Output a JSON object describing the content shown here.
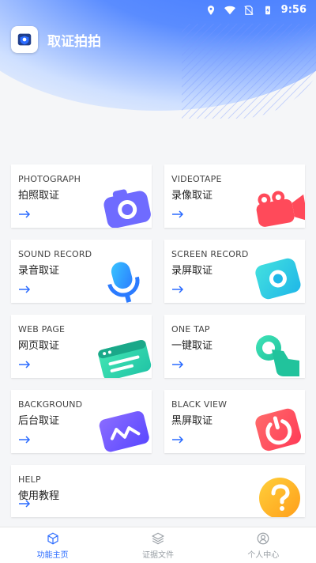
{
  "status": {
    "time": "9:56"
  },
  "app": {
    "title": "取证拍拍"
  },
  "cards": [
    {
      "en": "PHOTOGRAPH",
      "cn": "拍照取证",
      "icon": "camera-icon",
      "color": "#6f6bff"
    },
    {
      "en": "VIDEOTAPE",
      "cn": "录像取证",
      "icon": "video-camera-icon",
      "color": "#ff4a5a"
    },
    {
      "en": "SOUND RECORD",
      "cn": "录音取证",
      "icon": "microphone-icon",
      "color": "#2ea7ff"
    },
    {
      "en": "SCREEN RECORD",
      "cn": "录屏取证",
      "icon": "screen-record-icon",
      "color": "#29c7e6"
    },
    {
      "en": "WEB PAGE",
      "cn": "网页取证",
      "icon": "browser-icon",
      "color": "#2fd1b0"
    },
    {
      "en": "ONE TAP",
      "cn": "一键取证",
      "icon": "tap-icon",
      "color": "#27c9a1"
    },
    {
      "en": "BACKGROUND",
      "cn": "后台取证",
      "icon": "background-icon",
      "color": "#7b5cff"
    },
    {
      "en": "BLACK VIEW",
      "cn": "黑屏取证",
      "icon": "power-icon",
      "color": "#ff4a5a"
    },
    {
      "en": "HELP",
      "cn": "使用教程",
      "icon": "help-icon",
      "color": "#ffb31a"
    }
  ],
  "tabs": [
    {
      "label": "功能主页",
      "icon": "cube-icon",
      "active": true
    },
    {
      "label": "证据文件",
      "icon": "layers-icon",
      "active": false
    },
    {
      "label": "个人中心",
      "icon": "user-icon",
      "active": false
    }
  ],
  "colors": {
    "accent": "#2c6cff"
  }
}
